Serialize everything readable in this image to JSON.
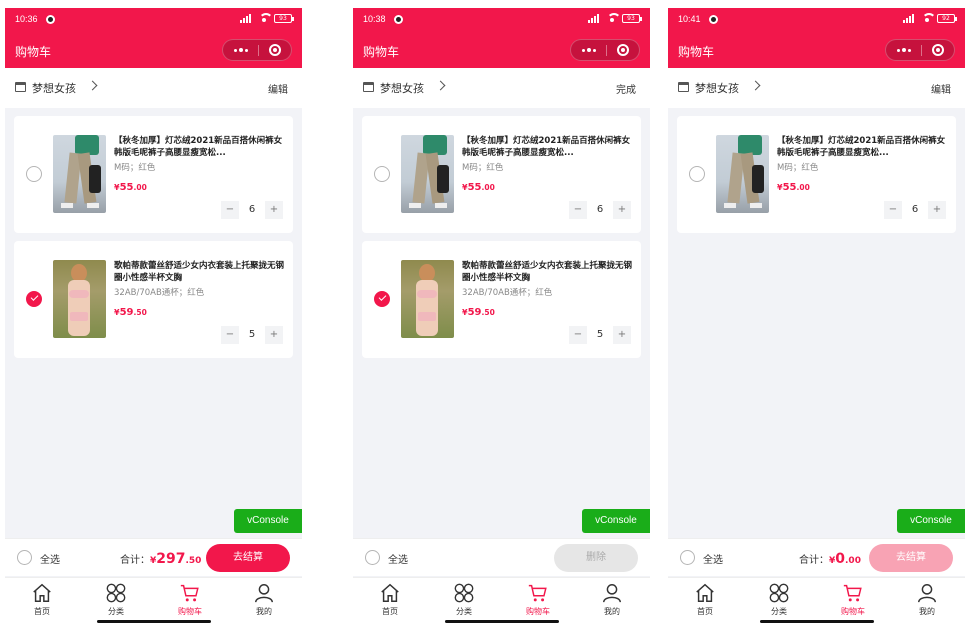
{
  "colors": {
    "brand": "#f2174b",
    "vconsole": "#1aad19",
    "muted_button": "#e6e6e6",
    "disabled_brand": "#f8a3b4"
  },
  "screens": [
    {
      "status_time": "10:36",
      "battery": "93",
      "nav_title": "购物车",
      "shop_name": "梦想女孩",
      "edit_label": "编辑",
      "items": [
        {
          "title": "【秋冬加厚】灯芯绒2021新品百搭休闲裤女韩版毛呢裤子高腰显瘦宽松...",
          "spec": "M码；红色",
          "price_currency": "¥",
          "price_int": "55",
          "price_dec": ".00",
          "qty": "6",
          "minus": "−",
          "plus": "+",
          "checked": false,
          "image": "pants-image"
        },
        {
          "title": "歌帕蒂款蕾丝舒适少女内衣套装上托聚拢无钢圈小性感半杯文胸",
          "spec": "32AB/70AB通杯；红色",
          "price_currency": "¥",
          "price_int": "59",
          "price_dec": ".50",
          "qty": "5",
          "minus": "−",
          "plus": "+",
          "checked": true,
          "image": "lingerie-image"
        }
      ],
      "vconsole": "vConsole",
      "select_all": "全选",
      "total_label": "合计：",
      "total_currency": "¥",
      "total_int": "297",
      "total_dec": ".50",
      "action": "去结算"
    },
    {
      "status_time": "10:38",
      "battery": "93",
      "nav_title": "购物车",
      "shop_name": "梦想女孩",
      "edit_label": "完成",
      "items": [
        {
          "title": "【秋冬加厚】灯芯绒2021新品百搭休闲裤女韩版毛呢裤子高腰显瘦宽松...",
          "spec": "M码；红色",
          "price_currency": "¥",
          "price_int": "55",
          "price_dec": ".00",
          "qty": "6",
          "minus": "−",
          "plus": "+",
          "checked": false,
          "image": "pants-image"
        },
        {
          "title": "歌帕蒂款蕾丝舒适少女内衣套装上托聚拢无钢圈小性感半杯文胸",
          "spec": "32AB/70AB通杯；红色",
          "price_currency": "¥",
          "price_int": "59",
          "price_dec": ".50",
          "qty": "5",
          "minus": "−",
          "plus": "+",
          "checked": true,
          "image": "lingerie-image"
        }
      ],
      "vconsole": "vConsole",
      "select_all": "全选",
      "action": "删除"
    },
    {
      "status_time": "10:41",
      "battery": "92",
      "nav_title": "购物车",
      "shop_name": "梦想女孩",
      "edit_label": "编辑",
      "items": [
        {
          "title": "【秋冬加厚】灯芯绒2021新品百搭休闲裤女韩版毛呢裤子高腰显瘦宽松...",
          "spec": "M码；红色",
          "price_currency": "¥",
          "price_int": "55",
          "price_dec": ".00",
          "qty": "6",
          "minus": "−",
          "plus": "+",
          "checked": false,
          "image": "pants-image"
        }
      ],
      "vconsole": "vConsole",
      "select_all": "全选",
      "total_label": "合计：",
      "total_currency": "¥",
      "total_int": "0",
      "total_dec": ".00",
      "action": "去结算"
    }
  ],
  "tabbar": [
    {
      "label": "首页",
      "icon": "home-icon"
    },
    {
      "label": "分类",
      "icon": "category-icon"
    },
    {
      "label": "购物车",
      "icon": "cart-icon",
      "active": true
    },
    {
      "label": "我的",
      "icon": "user-icon"
    }
  ]
}
